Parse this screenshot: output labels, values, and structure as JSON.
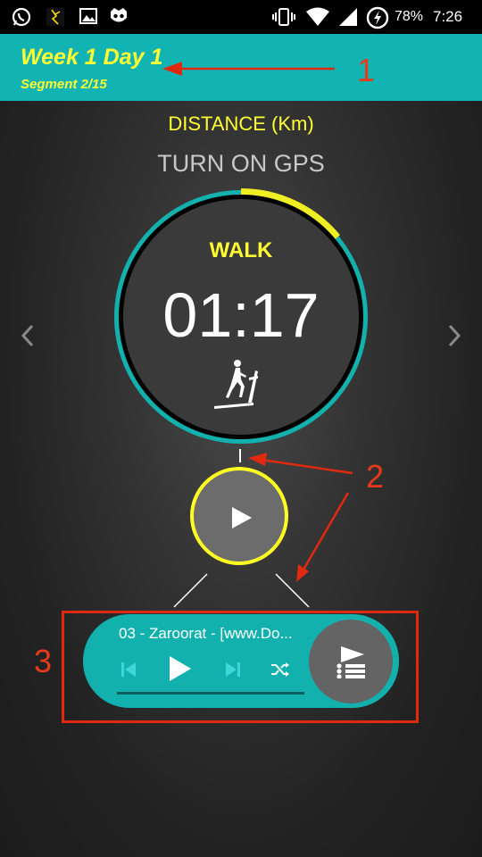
{
  "status_bar": {
    "battery": "78%",
    "time": "7:26",
    "icons": [
      "whatsapp-icon",
      "game-icon",
      "gallery-icon",
      "incognito-icon",
      "vibrate-icon",
      "wifi-icon",
      "signal-icon",
      "battery-icon"
    ]
  },
  "toolbar": {
    "title": "Week 1 Day 1",
    "subtitle": "Segment 2/15"
  },
  "metric": {
    "label": "DISTANCE (Km)",
    "value": "TURN ON GPS"
  },
  "timer": {
    "activity": "WALK",
    "time": "01:17",
    "segment_progress_fraction": 0.14
  },
  "music_player": {
    "track": "03 - Zaroorat - [www.Do..."
  },
  "annotations": [
    "1",
    "2",
    "3"
  ],
  "colors": {
    "accent_teal": "#13b1ad",
    "highlight_yellow": "#ffff33",
    "annotation_red": "#e02a10"
  }
}
